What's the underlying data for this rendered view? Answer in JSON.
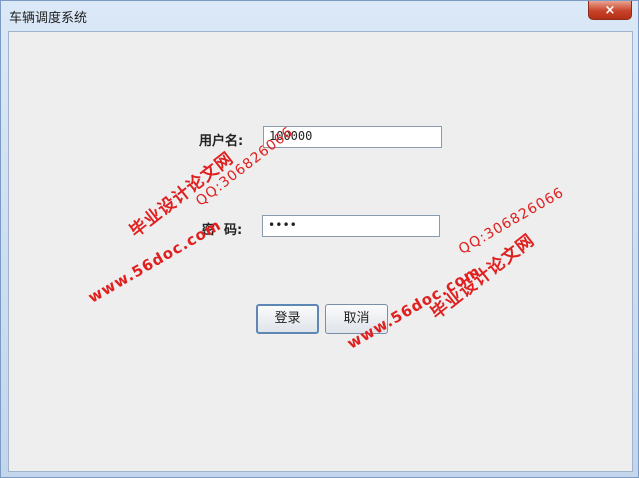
{
  "window": {
    "title": "车辆调度系统",
    "close_label": "×"
  },
  "form": {
    "username_label": "用户名:",
    "username_value": "100000",
    "password_label": "密  码:",
    "password_value": "••••",
    "login_button": "登录",
    "cancel_button": "取消"
  },
  "watermarks": {
    "site": "www.56doc.com",
    "qq": "QQ:306826066",
    "brand": "毕业设计论文网"
  },
  "colors": {
    "watermark": "#e01f1f",
    "close": "#c8432a",
    "background": "#eeeeee"
  }
}
